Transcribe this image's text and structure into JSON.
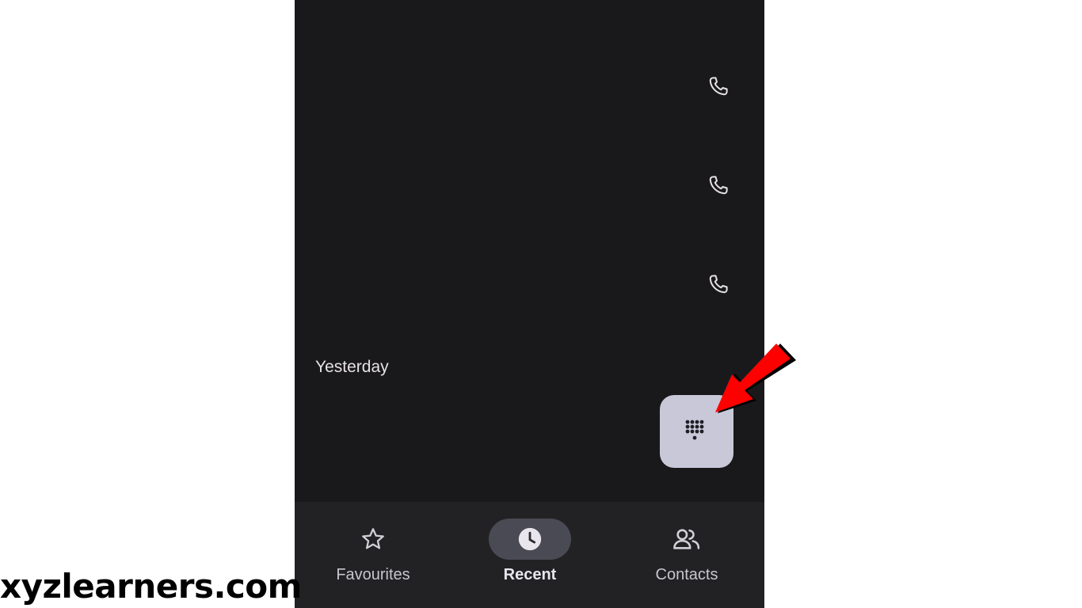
{
  "call_log": {
    "section_header": "Yesterday",
    "call_buttons": [
      {
        "icon": "phone-icon"
      },
      {
        "icon": "phone-icon"
      },
      {
        "icon": "phone-icon"
      }
    ]
  },
  "fab": {
    "icon": "dialpad-icon",
    "color": "#c8c8d8"
  },
  "bottom_nav": {
    "items": [
      {
        "label": "Favourites",
        "icon": "star-icon",
        "active": false
      },
      {
        "label": "Recent",
        "icon": "clock-icon",
        "active": true
      },
      {
        "label": "Contacts",
        "icon": "contacts-icon",
        "active": false
      }
    ]
  },
  "watermark": "xyzlearners.com",
  "annotation": {
    "icon": "red-arrow-icon",
    "color": "#ff0000"
  }
}
